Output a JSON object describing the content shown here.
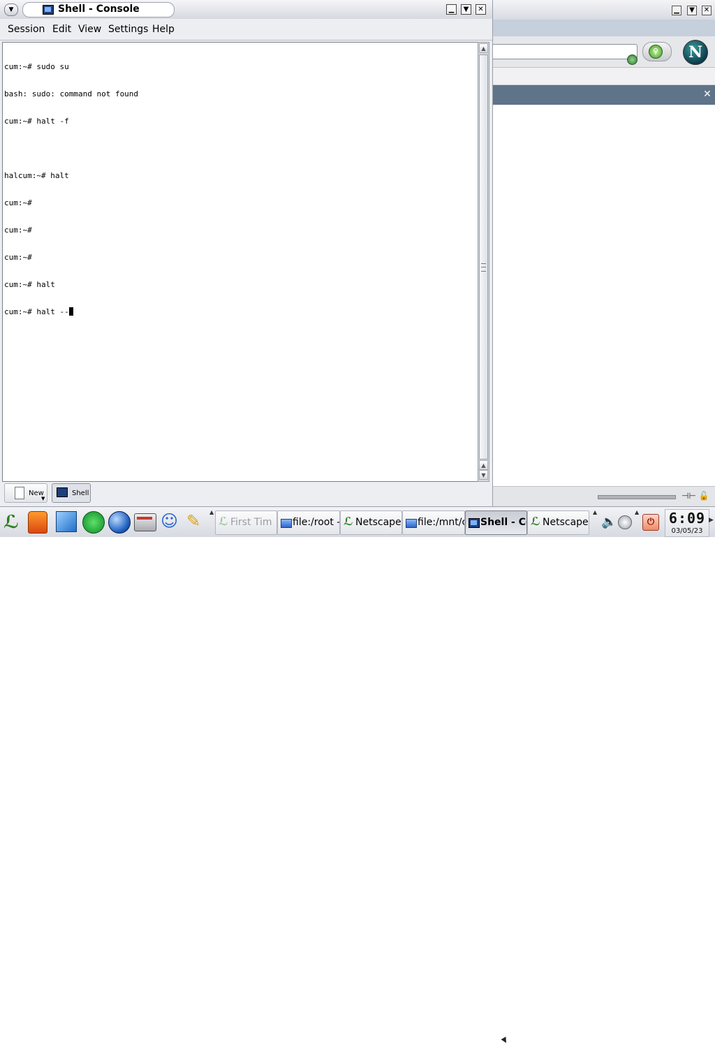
{
  "konsole": {
    "title": "Shell - Console",
    "controls": {
      "minimize": "▁",
      "maximize": "▼",
      "close": "✕"
    },
    "menus": [
      "Session",
      "Edit",
      "View",
      "Settings",
      "Help"
    ],
    "terminal_lines": [
      "cum:~# sudo su",
      "bash: sudo: command not found",
      "cum:~# halt -f",
      "",
      "halcum:~# halt",
      "cum:~#",
      "cum:~#",
      "cum:~#",
      "cum:~# halt",
      "cum:~# halt --"
    ],
    "tabs": {
      "new_label": "New",
      "shell_label": "Shell"
    }
  },
  "background_window": {
    "controls": {
      "minimize": "▁",
      "maximize": "▼",
      "close": "✕"
    },
    "logo_letter": "N",
    "panel_close": "✕"
  },
  "taskbar": {
    "launchers": [
      "kmenu-icon",
      "vest-icon",
      "cube-icon",
      "runner-icon",
      "globe-icon",
      "mailbox-icon",
      "people-icon",
      "pen-icon"
    ],
    "tasks": [
      {
        "label": "First Tim",
        "icon": "first-time-icon",
        "dim": true
      },
      {
        "label": "file:/root -",
        "icon": "folder-icon",
        "dim": false
      },
      {
        "label": "Netscape",
        "icon": "netscape-icon",
        "dim": false
      },
      {
        "label": "file:/mnt/c",
        "icon": "folder-icon",
        "dim": false
      },
      {
        "label": "Shell - Co",
        "icon": "terminal-icon",
        "dim": false,
        "active": true
      },
      {
        "label": "Netscape",
        "icon": "netscape-icon",
        "dim": false
      }
    ],
    "clock": {
      "time": "6:09",
      "date": "03/05/23"
    }
  }
}
